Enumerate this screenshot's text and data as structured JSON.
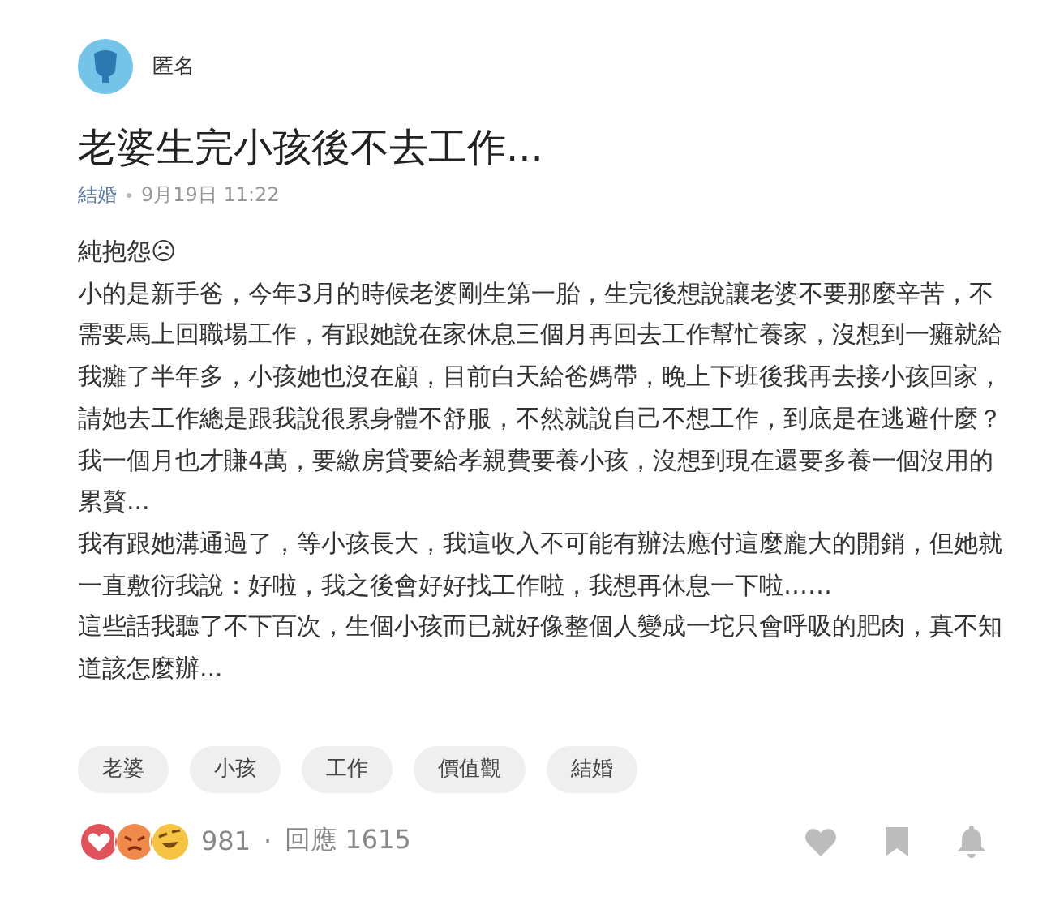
{
  "author": {
    "name": "匿名"
  },
  "title": "老婆生完小孩後不去工作...",
  "meta": {
    "forum": "結婚",
    "time": "9月19日 11:22"
  },
  "paragraphs": [
    {
      "lines": [
        "純抱怨☹"
      ]
    },
    {
      "lines": [
        "小的是新手爸，今年3月的時候老婆剛生第一胎，生完後想說讓老婆不要那麼辛苦，不",
        "需要馬上回職場工作，有跟她說在家休息三個月再回去工作幫忙養家，沒想到一癱就給",
        "我癱了半年多，小孩她也沒在顧，目前白天給爸媽帶，晚上下班後我再去接小孩回家，",
        "請她去工作總是跟我說很累身體不舒服，不然就說自己不想工作，到底是在逃避什麼？"
      ]
    },
    {
      "lines": [
        "我一個月也才賺4萬，要繳房貸要給孝親費要養小孩，沒想到現在還要多養一個沒用的",
        "累贅..."
      ]
    },
    {
      "lines": [
        "我有跟她溝通過了，等小孩長大，我這收入不可能有辦法應付這麼龐大的開銷，但她就",
        "一直敷衍我說：好啦，我之後會好好找工作啦，我想再休息一下啦……"
      ]
    },
    {
      "lines": [
        "這些話我聽了不下百次，生個小孩而已就好像整個人變成一坨只會呼吸的肥肉，真不知",
        "道該怎麼辦..."
      ]
    }
  ],
  "tags": [
    "老婆",
    "小孩",
    "工作",
    "價值觀",
    "結婚"
  ],
  "footer": {
    "reaction_count": "981",
    "separator": "·",
    "replies_label": "回應",
    "replies_count": "1615"
  }
}
